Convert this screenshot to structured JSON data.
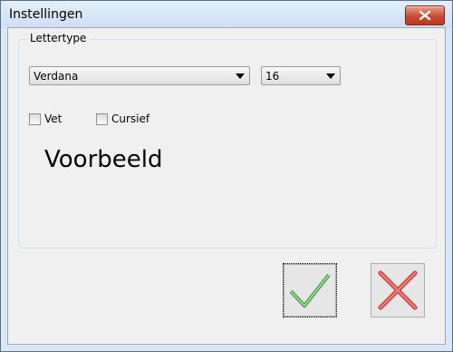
{
  "window": {
    "title": "Instellingen",
    "close_icon": "close-icon"
  },
  "font_group": {
    "legend": "Lettertype",
    "font_family": "Verdana",
    "font_size": "16",
    "bold_label": "Vet",
    "bold_checked": false,
    "italic_label": "Cursief",
    "italic_checked": false,
    "preview_text": "Voorbeeld"
  },
  "buttons": {
    "ok_icon": "checkmark-icon",
    "cancel_icon": "x-icon"
  },
  "colors": {
    "close_button": "#c74a32",
    "ok_check": "#5dbf5d",
    "cancel_x": "#e0524f"
  }
}
